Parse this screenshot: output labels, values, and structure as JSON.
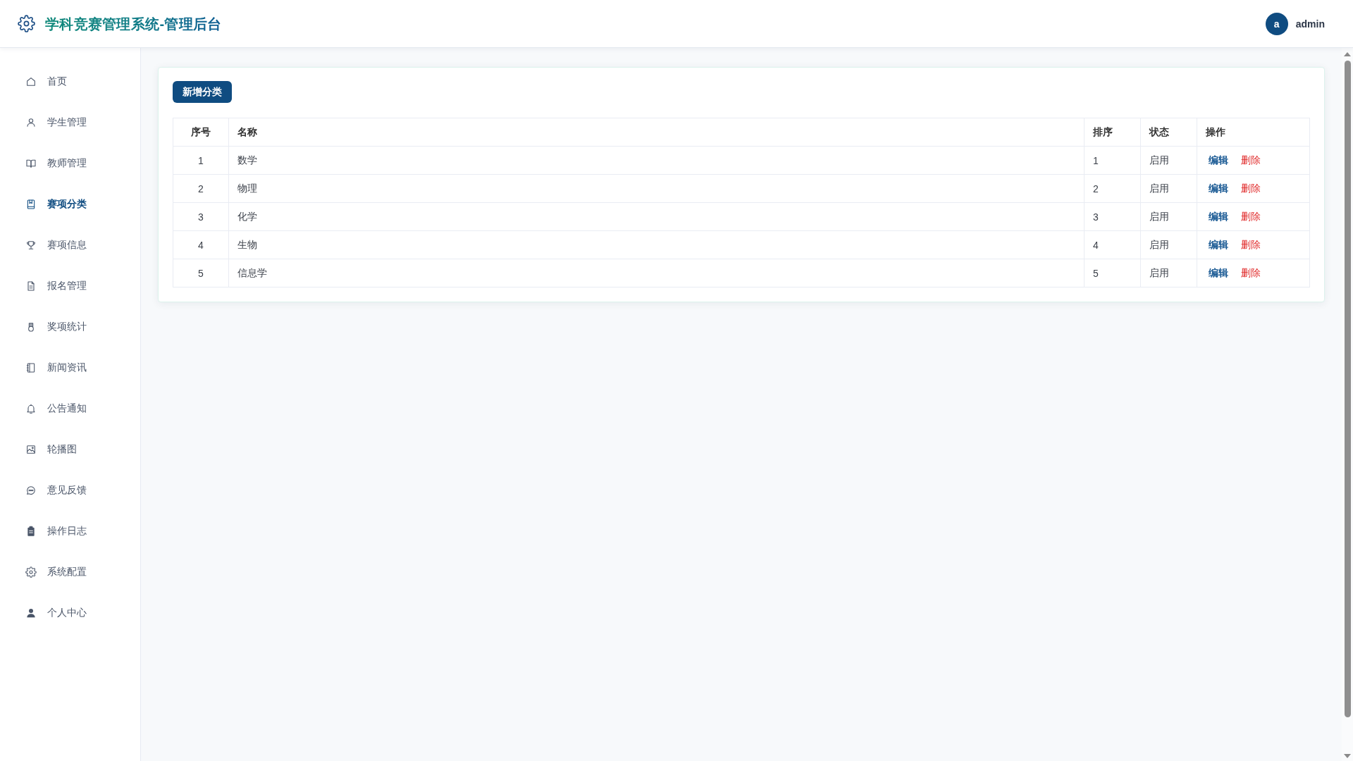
{
  "header": {
    "title": "学科竞赛管理系统-管理后台",
    "user": {
      "avatar_letter": "a",
      "name": "admin"
    }
  },
  "sidebar": {
    "items": [
      {
        "label": "首页",
        "selected": false
      },
      {
        "label": "学生管理",
        "selected": false
      },
      {
        "label": "教师管理",
        "selected": false
      },
      {
        "label": "赛项分类",
        "selected": true
      },
      {
        "label": "赛项信息",
        "selected": false
      },
      {
        "label": "报名管理",
        "selected": false
      },
      {
        "label": "奖项统计",
        "selected": false
      },
      {
        "label": "新闻资讯",
        "selected": false
      },
      {
        "label": "公告通知",
        "selected": false
      },
      {
        "label": "轮播图",
        "selected": false
      },
      {
        "label": "意见反馈",
        "selected": false
      },
      {
        "label": "操作日志",
        "selected": false
      },
      {
        "label": "系统配置",
        "selected": false
      },
      {
        "label": "个人中心",
        "selected": false
      }
    ]
  },
  "toolbar": {
    "add_button": "新增分类"
  },
  "table": {
    "columns": [
      "序号",
      "名称",
      "排序",
      "状态",
      "操作"
    ],
    "rows": [
      {
        "index": "1",
        "name": "数学",
        "sort": "1",
        "status": "启用",
        "actions": [
          {
            "label": "编辑",
            "kind": "edit"
          },
          {
            "label": "删除",
            "kind": "delete"
          }
        ]
      },
      {
        "index": "2",
        "name": "物理",
        "sort": "2",
        "status": "启用",
        "actions": [
          {
            "label": "编辑",
            "kind": "edit"
          },
          {
            "label": "删除",
            "kind": "delete"
          }
        ]
      },
      {
        "index": "3",
        "name": "化学",
        "sort": "3",
        "status": "启用",
        "actions": [
          {
            "label": "编辑",
            "kind": "edit"
          },
          {
            "label": "删除",
            "kind": "delete"
          }
        ]
      },
      {
        "index": "4",
        "name": "生物",
        "sort": "4",
        "status": "启用",
        "actions": [
          {
            "label": "编辑",
            "kind": "edit"
          },
          {
            "label": "删除",
            "kind": "delete"
          }
        ]
      },
      {
        "index": "5",
        "name": "信息学",
        "sort": "5",
        "status": "启用",
        "actions": [
          {
            "label": "编辑",
            "kind": "edit"
          },
          {
            "label": "删除",
            "kind": "delete"
          }
        ]
      }
    ]
  }
}
